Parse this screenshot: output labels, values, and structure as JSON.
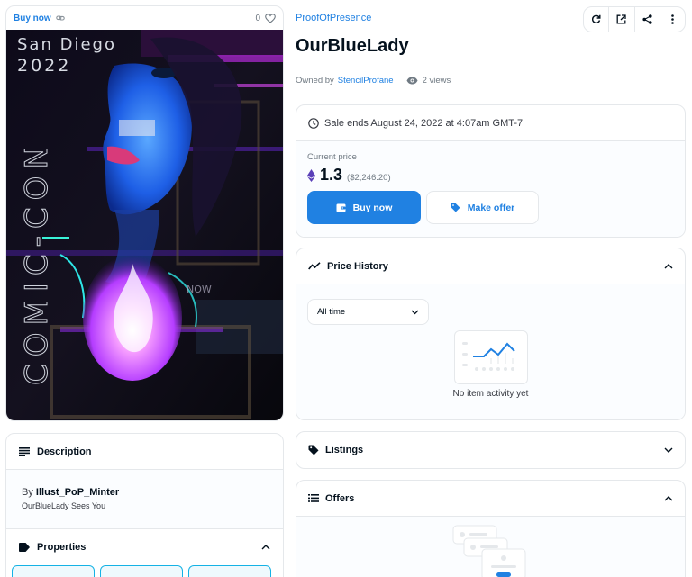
{
  "image_card": {
    "buy_now_label": "Buy now",
    "favorites_count": "0"
  },
  "description": {
    "header": "Description",
    "by_prefix": "By",
    "creator": "Illust_PoP_Minter",
    "text": "OurBlueLady Sees You"
  },
  "properties": {
    "header": "Properties"
  },
  "collection": "ProofOfPresence",
  "title": "OurBlueLady",
  "owner": {
    "prefix": "Owned by",
    "name": "StencilProfane",
    "views": "2 views"
  },
  "sale": {
    "ends_text": "Sale ends August 24, 2022 at 4:07am GMT-7",
    "price_label": "Current price",
    "eth_price": "1.3",
    "usd_price": "($2,246.20)",
    "buy_button": "Buy now",
    "offer_button": "Make offer"
  },
  "price_history": {
    "header": "Price History",
    "time_filter": "All time",
    "empty_text": "No item activity yet"
  },
  "listings": {
    "header": "Listings"
  },
  "offers": {
    "header": "Offers"
  },
  "artwork": {
    "text_line1": "San Diego",
    "text_line2": "2022",
    "vertical_text": "COMIC-CON",
    "overlay_text": "NOW"
  },
  "colors": {
    "accent": "#2081e2",
    "border": "#e5e8eb",
    "text_primary": "#04111d",
    "text_secondary": "#707a83"
  }
}
